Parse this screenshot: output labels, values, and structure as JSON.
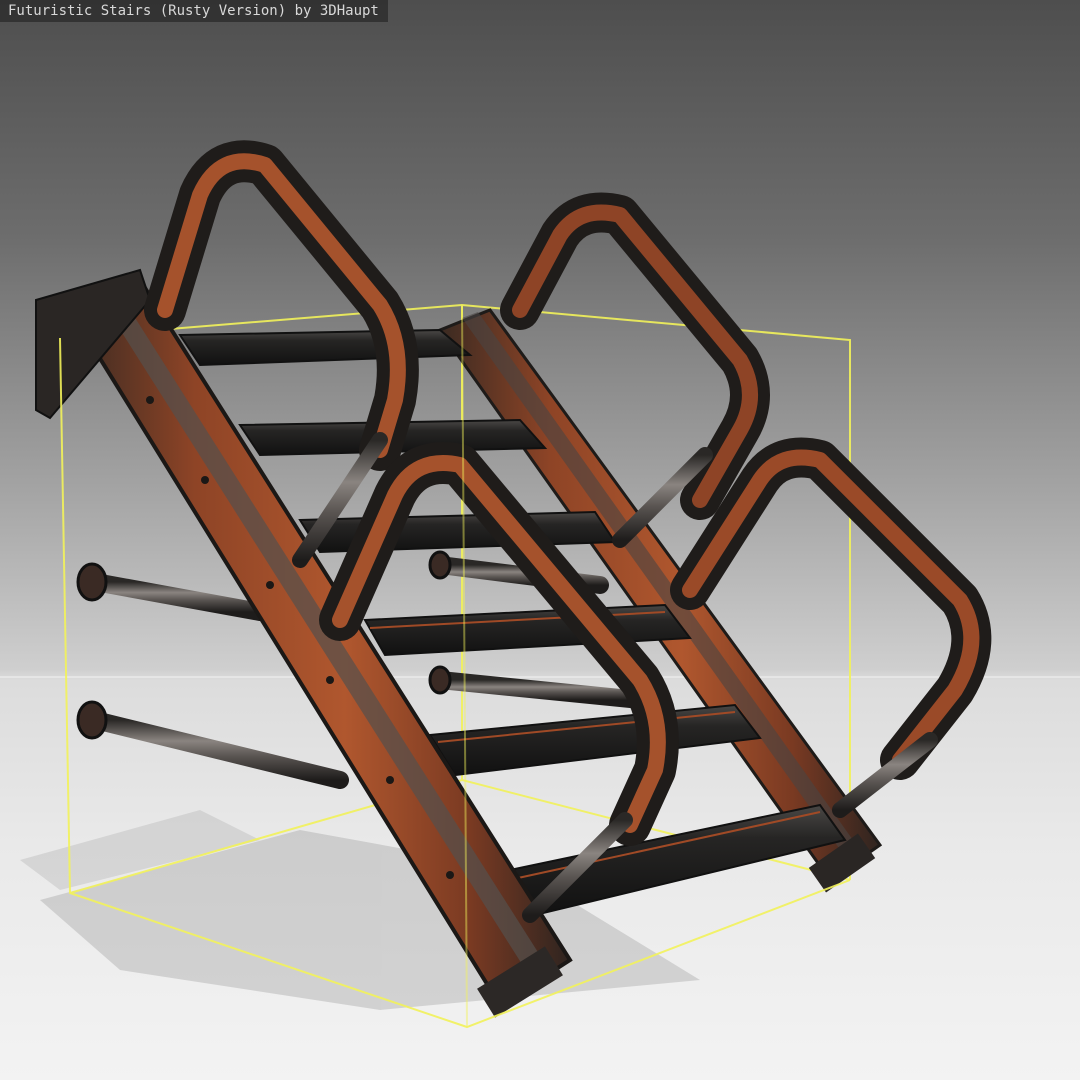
{
  "viewer": {
    "model_title": "Futuristic Stairs (Rusty Version) by 3DHaupt",
    "bounding_box_color": "#f2f25a",
    "rust_color": "#b0572e",
    "metal_color": "#5a5552",
    "background_top": "#4e4e4e",
    "background_bottom": "#f3f3f3",
    "selection": "bounding-box-visible"
  }
}
